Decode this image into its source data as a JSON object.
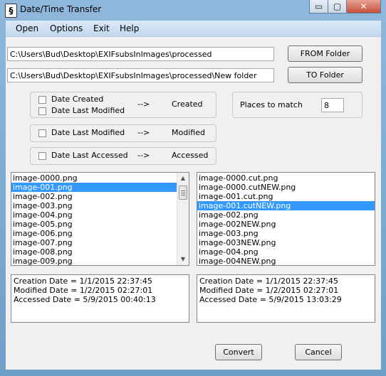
{
  "window": {
    "title": "Date/Time Transfer",
    "icon_glyph": "§",
    "minimize_glyph": "▭",
    "maximize_glyph": "▢",
    "close_glyph": "✕"
  },
  "menu": {
    "items": [
      "Open",
      "Options",
      "Exit",
      "Help"
    ]
  },
  "paths": {
    "from_path": "C:\\Users\\Bud\\Desktop\\EXIFsubsInImages\\processed",
    "to_path": "C:\\Users\\Bud\\Desktop\\EXIFsubsInImages\\processed\\New folder",
    "from_button": "FROM Folder",
    "to_button": "TO Folder"
  },
  "options": {
    "group_created": {
      "date_created": "Date Created",
      "date_last_modified": "Date Last Modified",
      "arrow": "-->",
      "target": "Created"
    },
    "group_modified": {
      "date_last_modified": "Date Last Modified",
      "arrow": "-->",
      "target": "Modified"
    },
    "group_accessed": {
      "date_last_accessed": "Date Last Accessed",
      "arrow": "-->",
      "target": "Accessed"
    },
    "places_to_match": {
      "label": "Places to match",
      "value": "8"
    }
  },
  "from_list": {
    "items": [
      "image-0000.png",
      "image-001.png",
      "image-002.png",
      "image-003.png",
      "image-004.png",
      "image-005.png",
      "image-006.png",
      "image-007.png",
      "image-008.png",
      "image-009.png"
    ],
    "selected_index": 1
  },
  "to_list": {
    "items": [
      "image-0000.cut.png",
      "image-0000.cutNEW.png",
      "image-001.cut.png",
      "image-001.cutNEW.png",
      "image-002.png",
      "image-002NEW.png",
      "image-003.png",
      "image-003NEW.png",
      "image-004.png",
      "image-004NEW.png"
    ],
    "selected_index": 3
  },
  "from_info": {
    "creation": "Creation Date = 1/1/2015 22:37:45",
    "modified": "Modified Date = 1/2/2015 02:27:01",
    "accessed": "Accessed Date = 5/9/2015 00:40:13"
  },
  "to_info": {
    "creation": "Creation Date = 1/1/2015 22:37:45",
    "modified": "Modified Date = 1/2/2015 02:27:01",
    "accessed": "Accessed Date = 5/9/2015 13:03:29"
  },
  "actions": {
    "convert": "Convert",
    "cancel": "Cancel"
  }
}
